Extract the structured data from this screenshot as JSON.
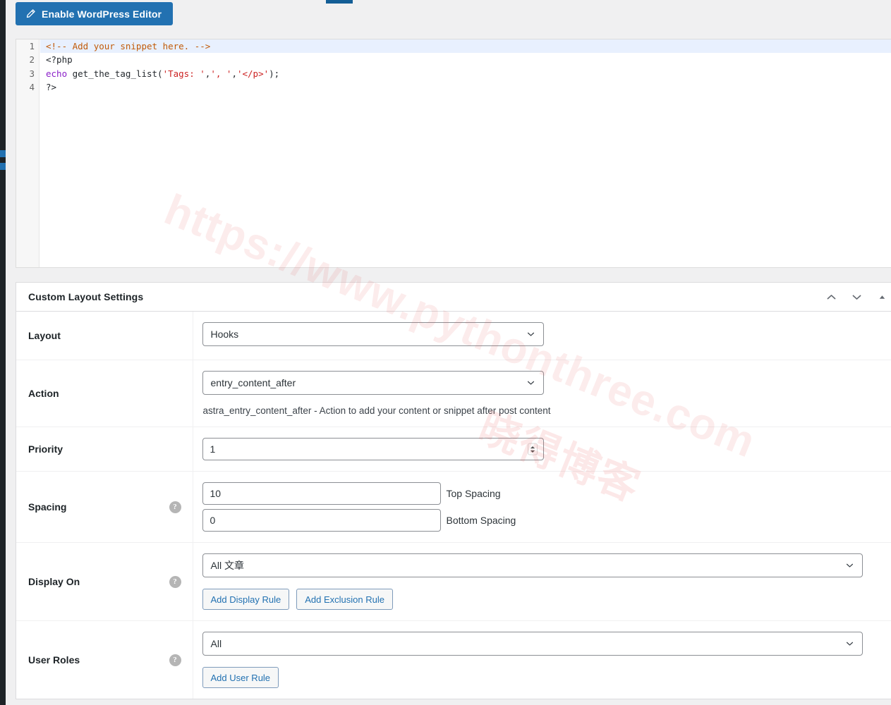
{
  "toolbar": {
    "enable_editor_label": "Enable WordPress Editor",
    "pencil_icon": "pencil-icon"
  },
  "code_editor": {
    "line_numbers": [
      "1",
      "2",
      "3",
      "4"
    ],
    "lines": [
      {
        "n": "1",
        "active": true,
        "text": "<!-- Add your snippet here. -->"
      },
      {
        "n": "2",
        "active": false,
        "text": "<?php"
      },
      {
        "n": "3",
        "active": false,
        "text": "echo get_the_tag_list('Tags: ',', ','</p>');"
      },
      {
        "n": "4",
        "active": false,
        "text": "?>"
      }
    ]
  },
  "metabox": {
    "title": "Custom Layout Settings",
    "actions": {
      "move_up": "chevron-up-icon",
      "move_down": "chevron-down-icon",
      "toggle": "triangle-up-icon"
    }
  },
  "fields": {
    "layout": {
      "label": "Layout",
      "value": "Hooks"
    },
    "action": {
      "label": "Action",
      "value": "entry_content_after",
      "description": "astra_entry_content_after - Action to add your content or snippet after post content"
    },
    "priority": {
      "label": "Priority",
      "value": "1"
    },
    "spacing": {
      "label": "Spacing",
      "top_value": "10",
      "top_label": "Top Spacing",
      "bottom_value": "0",
      "bottom_label": "Bottom Spacing"
    },
    "display_on": {
      "label": "Display On",
      "value": "All 文章",
      "add_display_rule": "Add Display Rule",
      "add_exclusion_rule": "Add Exclusion Rule"
    },
    "user_roles": {
      "label": "User Roles",
      "value": "All",
      "add_user_rule": "Add User Rule"
    }
  },
  "watermark": {
    "line1": "https://www.pythonthree.com",
    "line2": "晓得博客"
  },
  "colors": {
    "primary": "#2271b1",
    "link": "#2271b1",
    "active_line": "#e8f0fe",
    "comment": "#c25b09",
    "keyword": "#8b21c9",
    "string": "#cc2222"
  }
}
